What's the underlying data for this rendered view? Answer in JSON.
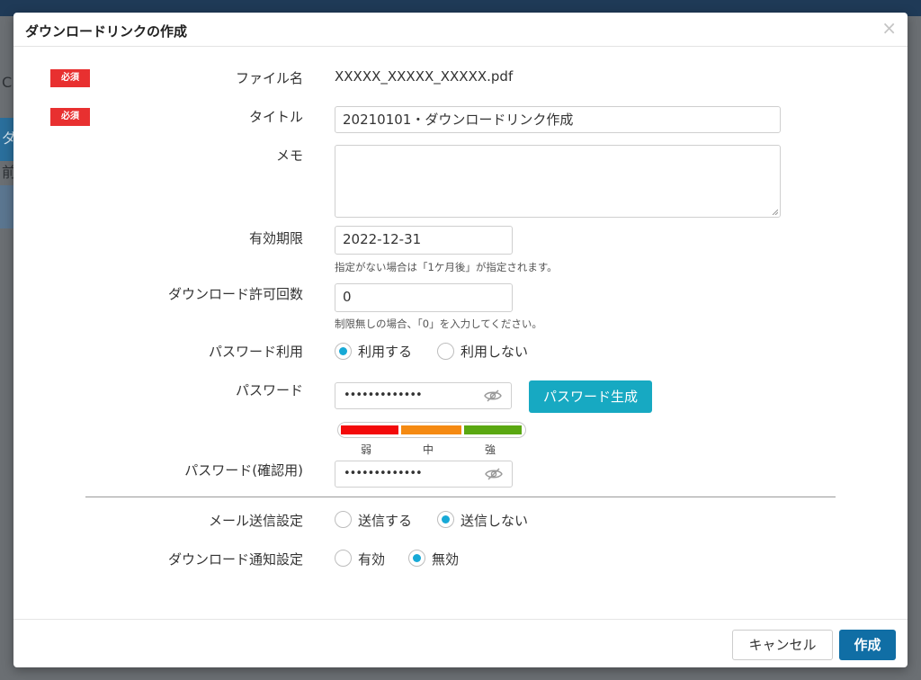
{
  "dialog": {
    "title": "ダウンロードリンクの作成",
    "close_glyph": "×"
  },
  "background": {
    "letter_1": "C",
    "letter_2": "ダ",
    "letter_3": "前"
  },
  "fields": {
    "required_badge": "必須",
    "file_name": {
      "label": "ファイル名",
      "value": "XXXXX_XXXXX_XXXXX.pdf"
    },
    "title": {
      "label": "タイトル",
      "value": "20210101・ダウンロードリンク作成"
    },
    "memo": {
      "label": "メモ",
      "value": ""
    },
    "expiry": {
      "label": "有効期限",
      "value": "2022-12-31",
      "hint": "指定がない場合は「1ケ月後」が指定されます。"
    },
    "download_count": {
      "label": "ダウンロード許可回数",
      "value": "0",
      "hint": "制限無しの場合、「0」を入力してください。"
    },
    "password_use": {
      "label": "パスワード利用",
      "options": [
        "利用する",
        "利用しない"
      ],
      "selected": "利用する"
    },
    "password": {
      "label": "パスワード",
      "masked": "•••••••••••••",
      "generate_label": "パスワード生成"
    },
    "strength": {
      "labels": [
        "弱",
        "中",
        "強"
      ],
      "colors": [
        "#f30a0a",
        "#f58a12",
        "#5aa811"
      ]
    },
    "password_confirm": {
      "label": "パスワード(確認用)",
      "masked": "•••••••••••••"
    },
    "mail_setting": {
      "label": "メール送信設定",
      "options": [
        "送信する",
        "送信しない"
      ],
      "selected": "送信しない"
    },
    "notify_setting": {
      "label": "ダウンロード通知設定",
      "options": [
        "有効",
        "無効"
      ],
      "selected": "無効"
    }
  },
  "footer": {
    "cancel_label": "キャンセル",
    "create_label": "作成"
  },
  "colors": {
    "accent": "#17a9d6",
    "primary_button": "#106ea5",
    "required_badge": "#e83030"
  }
}
